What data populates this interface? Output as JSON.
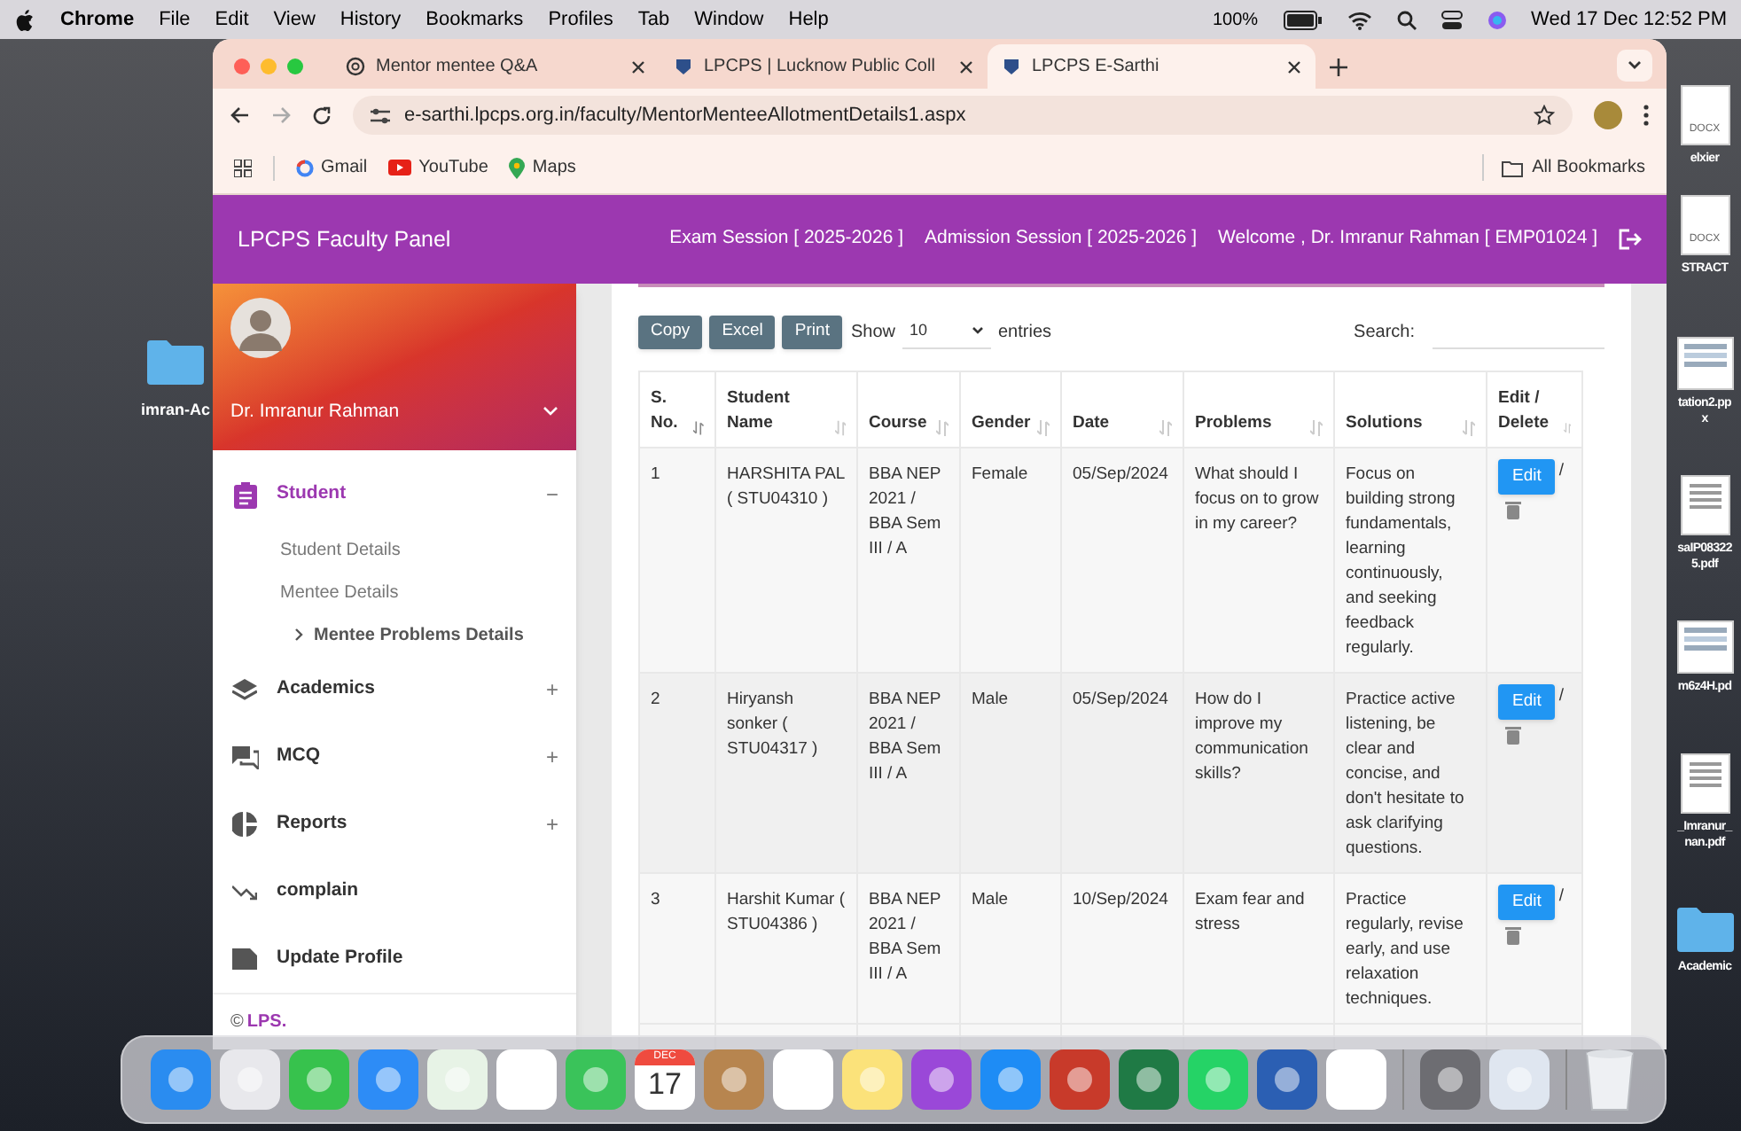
{
  "menu_bar": {
    "app": "Chrome",
    "items": [
      "File",
      "Edit",
      "View",
      "History",
      "Bookmarks",
      "Profiles",
      "Tab",
      "Window",
      "Help"
    ],
    "zoom": "100%",
    "clock": "Wed 17 Dec 12:52 PM"
  },
  "desktop": {
    "left_items": [
      {
        "kind": "folder",
        "lines": [
          "imran-Ac"
        ]
      }
    ],
    "right_items": [
      {
        "kind": "docx",
        "badge": "DOCX",
        "lines": [
          "elxier"
        ]
      },
      {
        "kind": "docx",
        "badge": "DOCX",
        "lines": [
          "STRACT"
        ]
      },
      {
        "kind": "image",
        "lines": [
          "tation2.pp",
          "x"
        ]
      },
      {
        "kind": "pdf",
        "lines": [
          "saIP08322",
          "5.pdf"
        ]
      },
      {
        "kind": "image",
        "lines": [
          "m6z4H.pd"
        ]
      },
      {
        "kind": "pdf",
        "lines": [
          "_Imranur_",
          "nan.pdf"
        ]
      },
      {
        "kind": "folder",
        "lines": [
          "Academic"
        ]
      }
    ]
  },
  "browser": {
    "tabs": [
      {
        "title": "Mentor mentee Q&A",
        "selected": false
      },
      {
        "title": "LPCPS | Lucknow Public Coll",
        "selected": false
      },
      {
        "title": "LPCPS E-Sarthi",
        "selected": true
      }
    ],
    "url": "e-sarthi.lpcps.org.in/faculty/MentorMenteeAllotmentDetails1.aspx",
    "bookmarks": [
      "Gmail",
      "YouTube",
      "Maps"
    ],
    "all_bookmarks": "All Bookmarks"
  },
  "header": {
    "title": "LPCPS Faculty Panel",
    "exam_session": "Exam Session [ 2025-2026 ]",
    "admission_session": "Admission Session [ 2025-2026 ]",
    "welcome": "Welcome , Dr. Imranur Rahman [ EMP01024 ]"
  },
  "sidebar": {
    "user": "Dr. Imranur Rahman",
    "items": [
      {
        "label": "Student",
        "toggle": "−",
        "selected": true,
        "children": [
          {
            "label": "Student Details",
            "selected": false
          },
          {
            "label": "Mentee Details",
            "selected": false
          },
          {
            "label": "Mentee Problems Details",
            "selected": true
          }
        ]
      },
      {
        "label": "Academics",
        "toggle": "+",
        "selected": false
      },
      {
        "label": "MCQ",
        "toggle": "+",
        "selected": false
      },
      {
        "label": "Reports",
        "toggle": "+",
        "selected": false
      },
      {
        "label": "complain",
        "selected": false
      },
      {
        "label": "Update Profile",
        "selected": false
      }
    ],
    "footer_prefix": "©",
    "footer_link": "LPS."
  },
  "toolbar": {
    "buttons": [
      "Copy",
      "Excel",
      "Print"
    ],
    "show": "Show",
    "page_size": "10",
    "entries": "entries",
    "search_label": "Search:"
  },
  "table": {
    "columns": [
      "S. No.",
      "Student Name",
      "Course",
      "Gender",
      "Date",
      "Problems",
      "Solutions",
      "Edit / Delete"
    ],
    "rows": [
      {
        "cells": [
          "1",
          "HARSHITA PAL ( STU04310 )",
          "BBA NEP 2021 / BBA Sem III / A",
          "Female",
          "05/Sep/2024",
          "What should I focus on to grow in my career?",
          "Focus on building strong fundamentals, learning continuously, and seeking feedback regularly."
        ],
        "edit": "Edit",
        "separator": "/"
      },
      {
        "cells": [
          "2",
          "Hiryansh sonker ( STU04317 )",
          "BBA NEP 2021 / BBA Sem III / A",
          "Male",
          "05/Sep/2024",
          "How do I improve my communication skills?",
          "Practice active listening, be clear and concise, and don't hesitate to ask clarifying questions."
        ],
        "edit": "Edit",
        "separator": "/"
      },
      {
        "cells": [
          "3",
          "Harshit Kumar ( STU04386 )",
          "BBA NEP 2021 / BBA Sem III / A",
          "Male",
          "10/Sep/2024",
          "Exam fear and stress",
          "Practice regularly, revise early, and use relaxation techniques."
        ],
        "edit": "Edit",
        "separator": "/"
      }
    ]
  },
  "dock": {
    "calendar_month": "DEC",
    "calendar_day": "17"
  }
}
